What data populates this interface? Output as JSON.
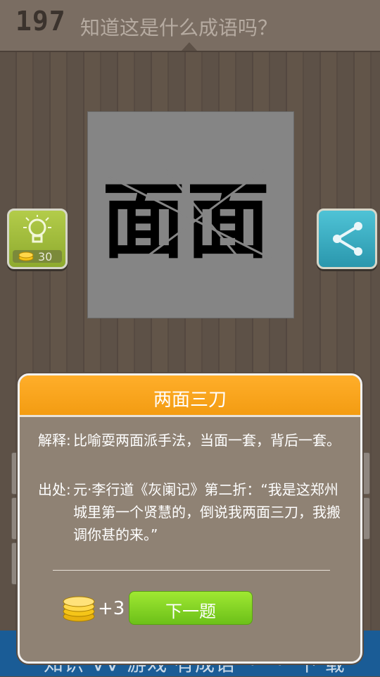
{
  "header": {
    "level": "197",
    "question": "知道这是什么成语吗？"
  },
  "puzzle": {
    "glyphs": [
      "面",
      "面"
    ]
  },
  "hint": {
    "cost": "30",
    "icon": "lightbulb-icon"
  },
  "share": {
    "icon": "share-icon"
  },
  "footer": {
    "ghost_text": "知识 VV 游戏 有成语 ・ ・ 下 载"
  },
  "dialog": {
    "title": "两面三刀",
    "explanation_label": "解释:",
    "explanation_text": "比喻耍两面派手法，当面一套，背后一套。",
    "source_label": "出处:",
    "source_text": "元·李行道《灰阑记》第二折：“我是这郑州城里第一个贤慧的，倒说我两面三刀，我搬调你甚的来。”",
    "reward": "+3",
    "next_label": "下一题"
  },
  "colors": {
    "dialog_header": "#f39c12",
    "next_button": "#7ed321",
    "hint_button": "#9cb83a",
    "share_button": "#3aaec2"
  }
}
